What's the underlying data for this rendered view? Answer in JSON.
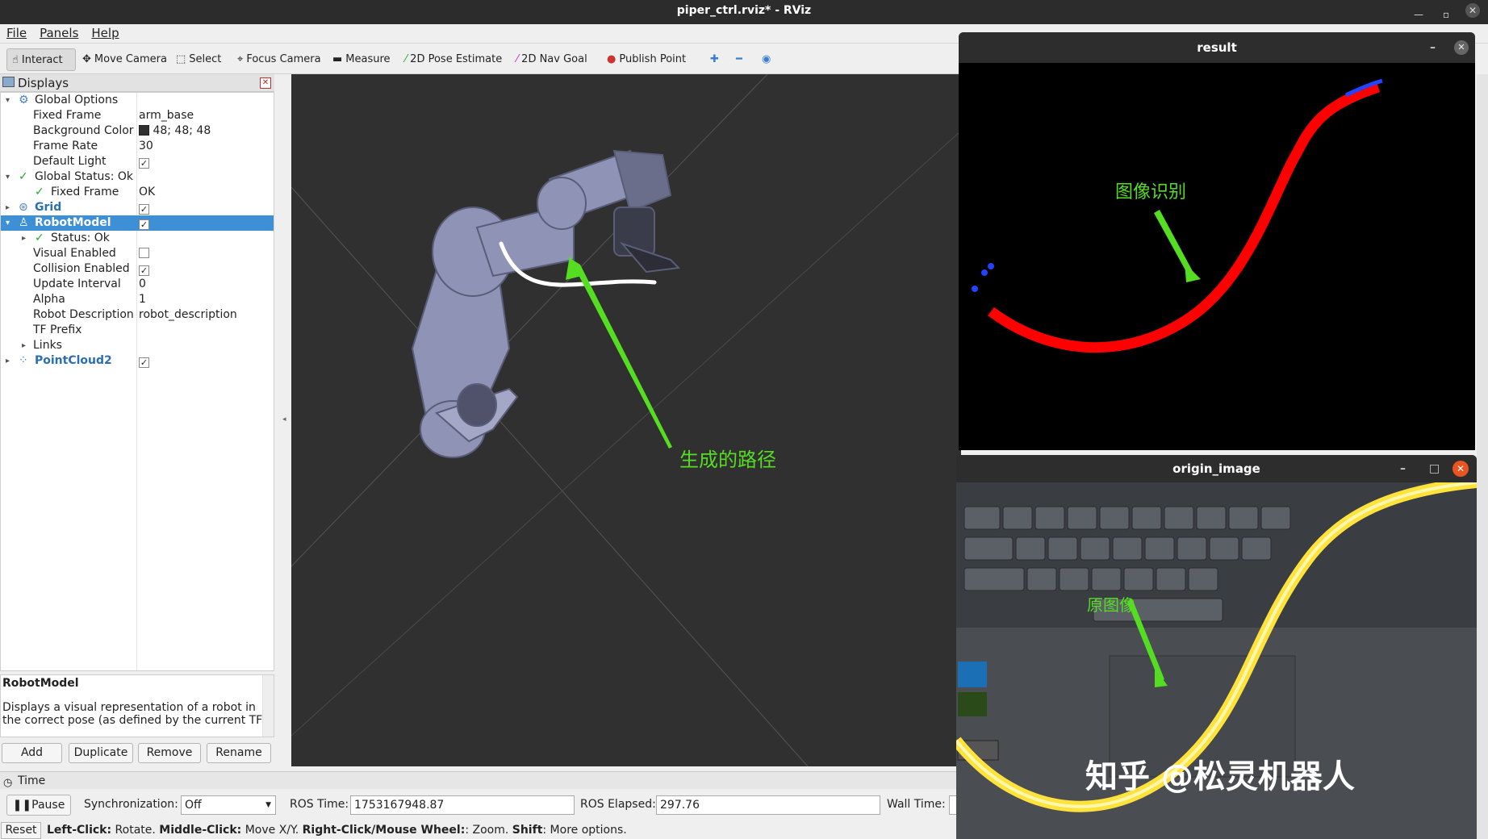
{
  "window": {
    "title": "piper_ctrl.rviz* - RViz"
  },
  "menu": [
    "File",
    "Panels",
    "Help"
  ],
  "toolbar": {
    "interact": "Interact",
    "move_camera": "Move Camera",
    "select": "Select",
    "focus_camera": "Focus Camera",
    "measure": "Measure",
    "pose_estimate": "2D Pose Estimate",
    "nav_goal": "2D Nav Goal",
    "publish_point": "Publish Point"
  },
  "displays": {
    "title": "Displays",
    "global_options": "Global Options",
    "fixed_frame_label": "Fixed Frame",
    "fixed_frame_value": "arm_base",
    "bg_color_label": "Background Color",
    "bg_color_value": "48; 48; 48",
    "frame_rate_label": "Frame Rate",
    "frame_rate_value": "30",
    "default_light_label": "Default Light",
    "global_status": "Global Status: Ok",
    "gs_fixed_frame": "Fixed Frame",
    "gs_fixed_frame_value": "OK",
    "grid": "Grid",
    "robot_model": "RobotModel",
    "rm_status": "Status: Ok",
    "visual_enabled": "Visual Enabled",
    "collision_enabled": "Collision Enabled",
    "update_interval_label": "Update Interval",
    "update_interval_value": "0",
    "alpha_label": "Alpha",
    "alpha_value": "1",
    "robot_desc_label": "Robot Description",
    "robot_desc_value": "robot_description",
    "tf_prefix": "TF Prefix",
    "links": "Links",
    "pointcloud": "PointCloud2"
  },
  "description": {
    "title": "RobotModel",
    "line1": "Displays a visual representation of a robot in",
    "line2": "the correct pose (as defined by the current TF"
  },
  "buttons": {
    "add": "Add",
    "duplicate": "Duplicate",
    "remove": "Remove",
    "rename": "Rename"
  },
  "view3d": {
    "annotation": "生成的路径"
  },
  "result": {
    "title": "result",
    "annotation": "图像识别"
  },
  "origin": {
    "title": "origin_image",
    "annotation": "原图像",
    "watermark": "知乎 @松灵机器人"
  },
  "time": {
    "header": "Time",
    "pause": "Pause",
    "sync_label": "Synchronization:",
    "sync_value": "Off",
    "ros_time_label": "ROS Time:",
    "ros_time_value": "1753167948.87",
    "ros_elapsed_label": "ROS Elapsed:",
    "ros_elapsed_value": "297.76",
    "wall_time_label": "Wall Time:"
  },
  "status": {
    "reset": "Reset",
    "left_click": "Left-Click:",
    "left_click_text": " Rotate. ",
    "middle_click": "Middle-Click:",
    "middle_click_text": " Move X/Y. ",
    "right_click": "Right-Click/Mouse Wheel:",
    "right_click_text": ": Zoom. ",
    "shift": "Shift",
    "shift_text": ": More options."
  },
  "colors": {
    "selection": "#3d8fd6",
    "annotation_green": "#55dd22",
    "path_red": "#ff0000",
    "viewport_bg": "#303030"
  }
}
